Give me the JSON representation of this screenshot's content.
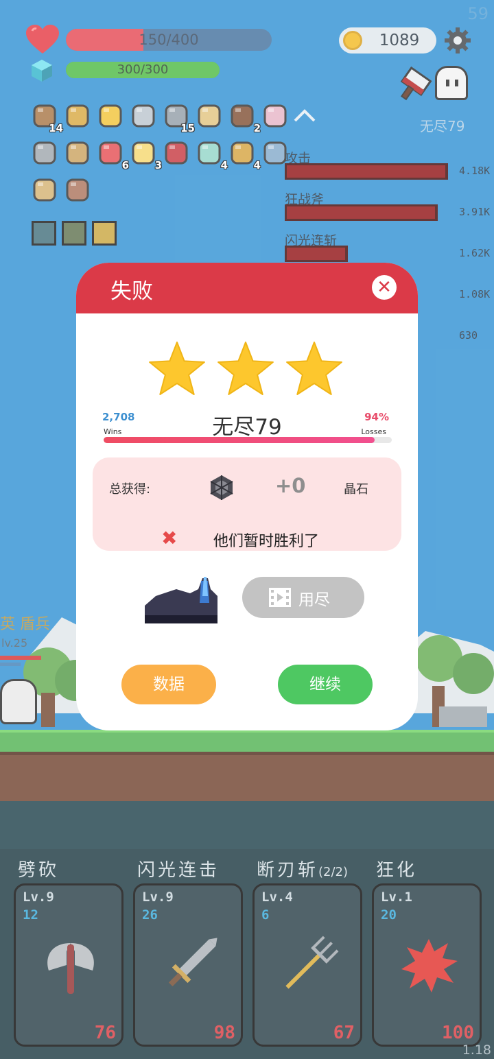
{
  "hud": {
    "fps": "59",
    "hp_text": "150/400",
    "hp_fraction": 0.375,
    "mp_text": "300/300",
    "mp_fraction": 1.0,
    "coins": "1089",
    "stage": "无尽79"
  },
  "items_row1": [
    {
      "icon": "round-shield-icon",
      "count": "14"
    },
    {
      "icon": "crossbow-icon",
      "count": ""
    },
    {
      "icon": "sun-amulet-icon",
      "count": ""
    },
    {
      "icon": "short-sword-icon",
      "count": ""
    },
    {
      "icon": "long-sword-icon",
      "count": "15"
    },
    {
      "icon": "treasure-map-icon",
      "count": ""
    },
    {
      "icon": "coconut-icon",
      "count": "2"
    },
    {
      "icon": "flower-icon",
      "count": ""
    }
  ],
  "items_row2": [
    {
      "icon": "war-hammer-icon",
      "count": ""
    },
    {
      "icon": "viking-helmet-icon",
      "count": ""
    },
    {
      "icon": "watermelon-icon",
      "count": "6"
    },
    {
      "icon": "ice-cream-icon",
      "count": "3"
    },
    {
      "icon": "magnet-icon",
      "count": ""
    },
    {
      "icon": "dagger-icon",
      "count": "4"
    },
    {
      "icon": "golden-egg-icon",
      "count": "4"
    },
    {
      "icon": "robe-icon",
      "count": ""
    }
  ],
  "items_row3": [
    {
      "icon": "scroll-map-icon",
      "count": ""
    },
    {
      "icon": "tombstone-icon",
      "count": ""
    }
  ],
  "buffs": [
    "radiance-buff-icon",
    "sword-buff-icon",
    "dark-figure-buff-icon"
  ],
  "damage_chart": {
    "type": "bar",
    "categories": [
      "攻击",
      "狂战斧",
      "闪光连斩",
      "",
      ""
    ],
    "value_labels": [
      "4.18K",
      "3.91K",
      "1.62K",
      "1.08K",
      "630"
    ],
    "values": [
      4180,
      3910,
      1620,
      1080,
      630
    ]
  },
  "enemy": {
    "name": "英 盾兵",
    "level": "lv.25"
  },
  "skills": [
    {
      "name": "劈砍",
      "extra": "",
      "level": "Lv.9",
      "cost": "12",
      "damage": "76",
      "icon": "battle-axe-icon"
    },
    {
      "name": "闪光连击",
      "extra": "",
      "level": "Lv.9",
      "cost": "26",
      "damage": "98",
      "icon": "sword-icon"
    },
    {
      "name": "断刃斩",
      "extra": "(2/2)",
      "level": "Lv.4",
      "cost": "6",
      "damage": "67",
      "icon": "pitchfork-icon"
    },
    {
      "name": "狂化",
      "extra": "",
      "level": "Lv.1",
      "cost": "20",
      "damage": "100",
      "icon": "blood-splat-icon"
    }
  ],
  "version": "1.18",
  "dialog": {
    "title": "失败",
    "stars": 3,
    "stage_name": "无尽79",
    "wins_value": "2,708",
    "wins_label": "Wins",
    "losses_value": "94%",
    "losses_label": "Losses",
    "loss_fraction": 0.94,
    "reward_label": "总获得:",
    "reward_amount": "+0",
    "reward_unit": "晶石",
    "fail_message": "他们暂时胜利了",
    "video_button": "用尽",
    "data_button": "数据",
    "continue_button": "继续"
  },
  "colors": {
    "sky": "#2a8ed2",
    "dialog_header": "#db3a48",
    "data_button": "#fbb049",
    "continue_button": "#4ec862"
  }
}
